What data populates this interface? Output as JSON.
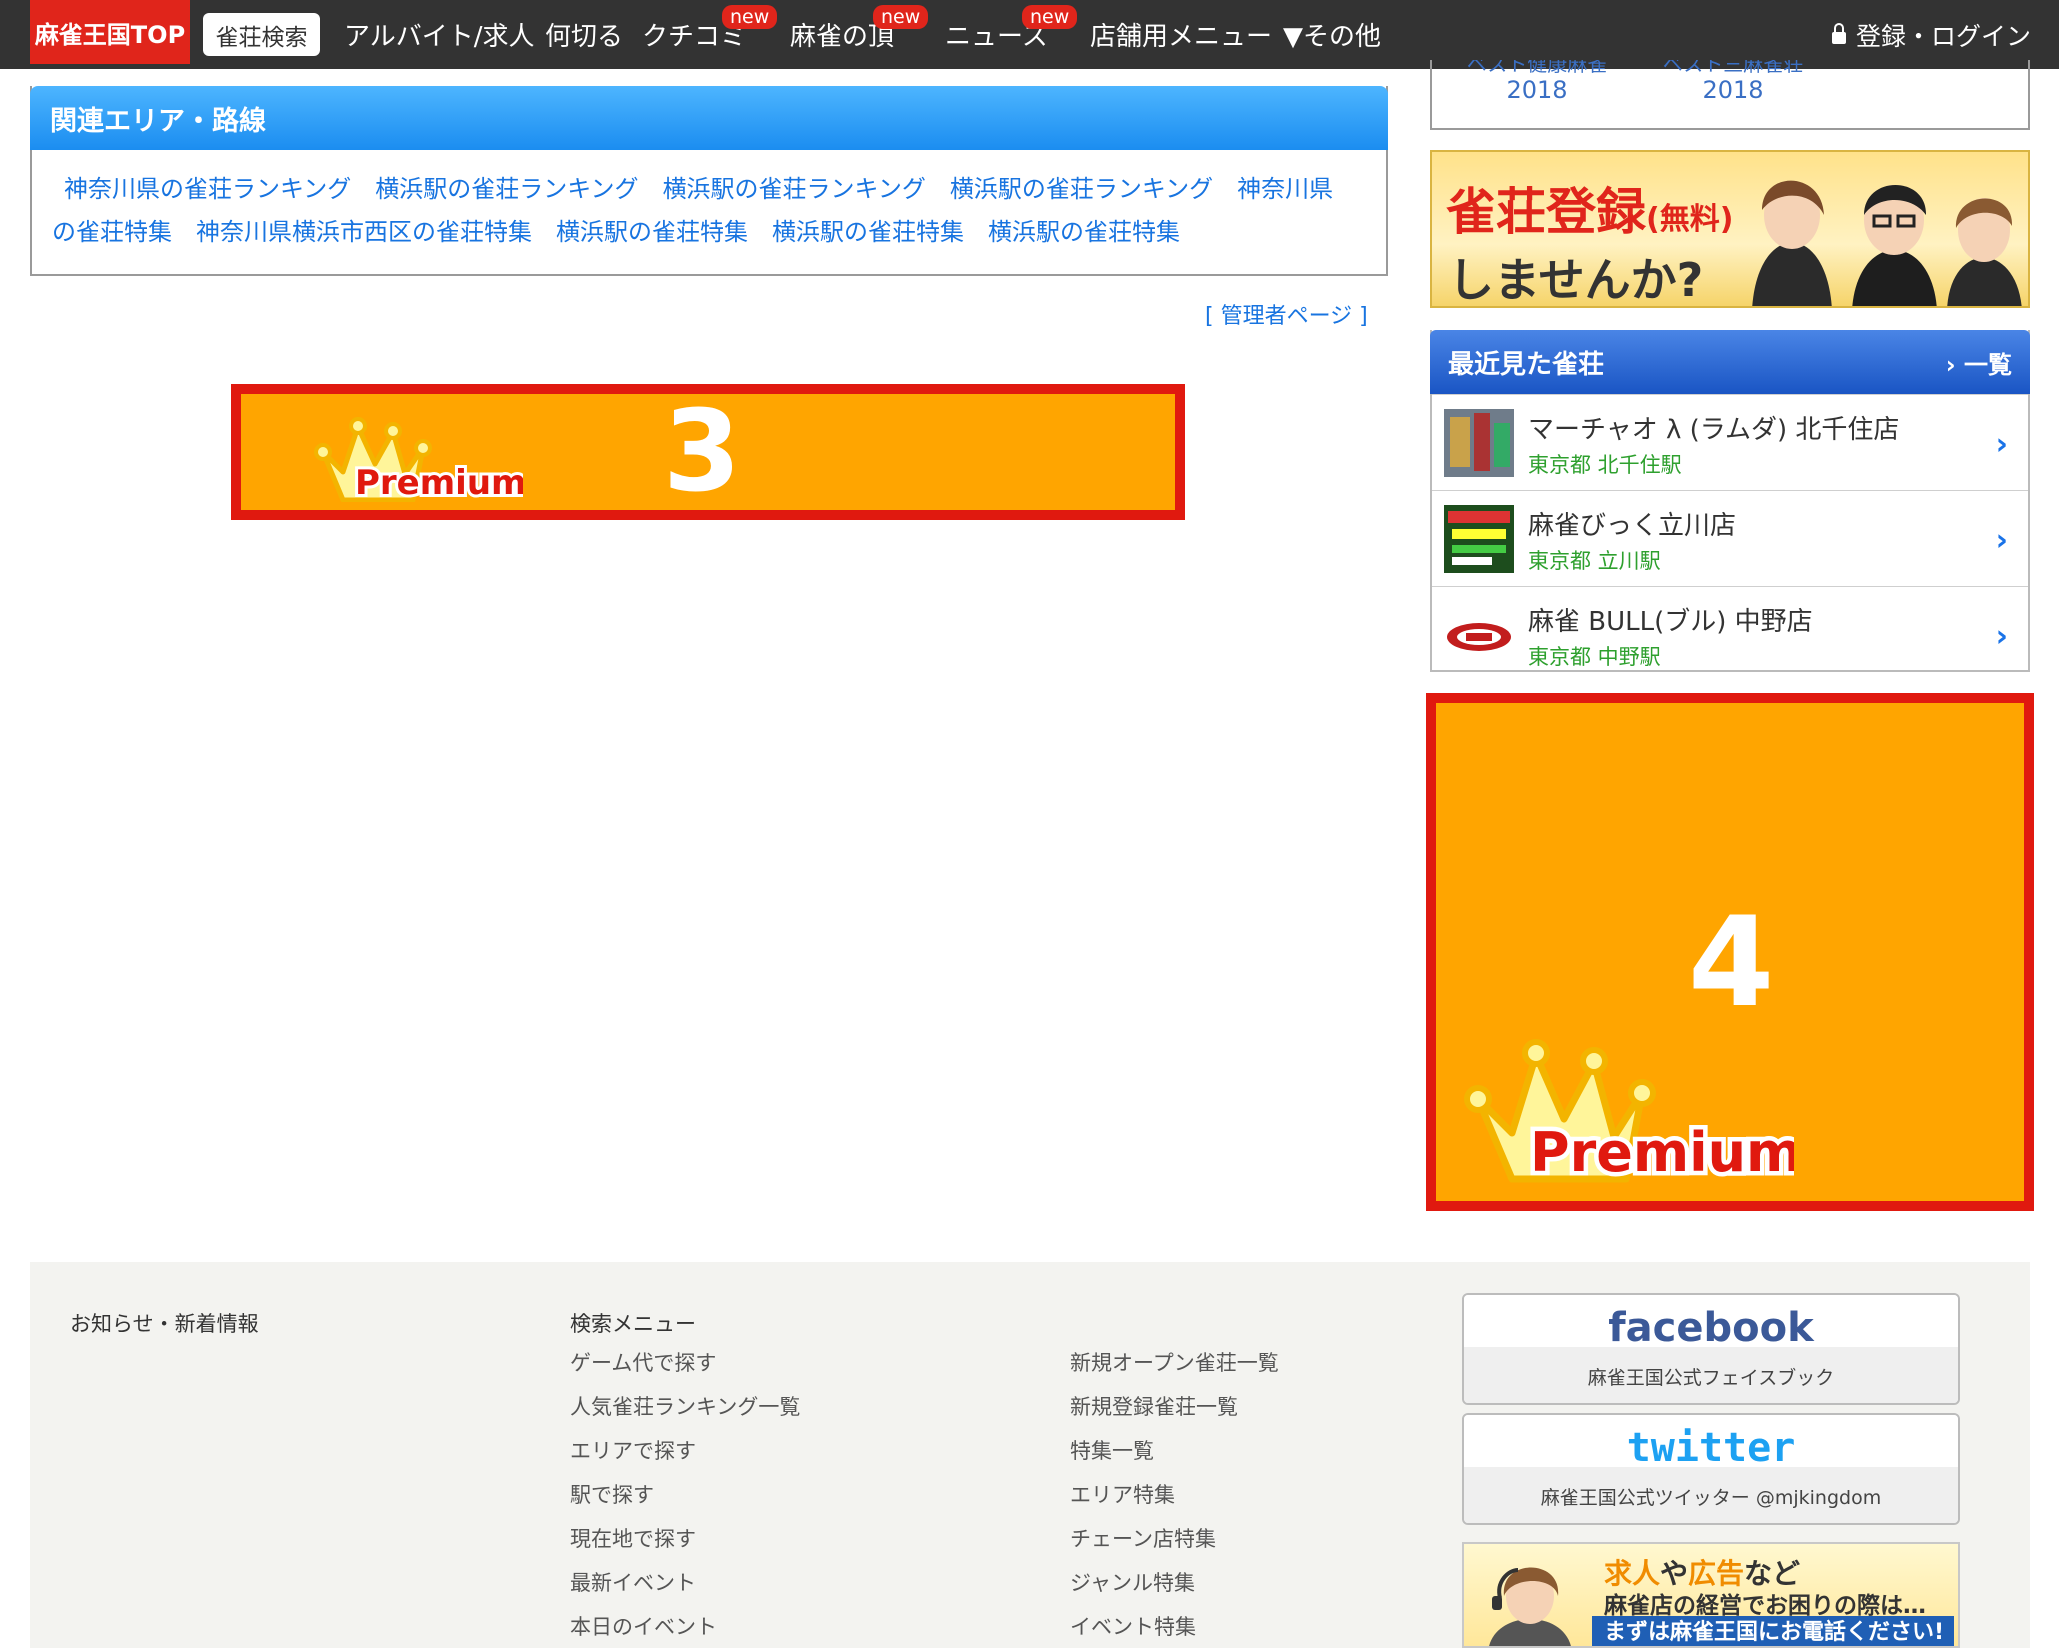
{
  "nav": {
    "top": "麻雀王国TOP",
    "search": "雀荘検索",
    "job": "アルバイト/求人",
    "nanikiru": "何切る",
    "kuchikomi": "クチコミ",
    "itadaki": "麻雀の頂",
    "news": "ニュース",
    "shop_menu": "店舗用メニュー",
    "other": "▼その他",
    "login": "登録・ログイン",
    "new_badge": "new"
  },
  "related": {
    "title": "関連エリア・路線",
    "links": [
      "神奈川県の雀荘ランキング",
      "横浜駅の雀荘ランキング",
      "横浜駅の雀荘ランキング",
      "横浜駅の雀荘ランキング",
      "神奈川県",
      "の雀荘特集",
      "神奈川県横浜市西区の雀荘特集",
      "横浜駅の雀荘特集",
      "横浜駅の雀荘特集",
      "横浜駅の雀荘特集"
    ]
  },
  "admin_link": "[ 管理者ページ ]",
  "premium": {
    "banner3_number": "3",
    "banner4_number": "4",
    "logo_text": "Premium"
  },
  "sidebar": {
    "awards": [
      {
        "label": "ベスト健康麻雀",
        "year": "2018"
      },
      {
        "label": "ベスト三麻雀荘",
        "year": "2018"
      }
    ],
    "signup": {
      "line1_main": "雀荘登録",
      "line1_small": "(無料)",
      "line2": "しませんか?"
    },
    "recent": {
      "title": "最近見た雀荘",
      "more": "一覧",
      "items": [
        {
          "name": "マーチャオ λ (ラムダ) 北千住店",
          "area": "東京都 北千住駅"
        },
        {
          "name": "麻雀びっく立川店",
          "area": "東京都 立川駅"
        },
        {
          "name": "麻雀 BULL(ブル) 中野店",
          "area": "東京都 中野駅"
        }
      ]
    }
  },
  "footer": {
    "news_title": "お知らせ・新着情報",
    "search_title": "検索メニュー",
    "col1": [
      "ゲーム代で探す",
      "人気雀荘ランキング一覧",
      "エリアで探す",
      "駅で探す",
      "現在地で探す",
      "最新イベント",
      "本日のイベント"
    ],
    "col2": [
      "新規オープン雀荘一覧",
      "新規登録雀荘一覧",
      "特集一覧",
      "エリア特集",
      "チェーン店特集",
      "ジャンル特集",
      "イベント特集"
    ],
    "facebook": {
      "logo": "facebook",
      "caption": "麻雀王国公式フェイスブック"
    },
    "twitter": {
      "logo": "twitter",
      "caption": "麻雀王国公式ツイッター @mjkingdom"
    },
    "contact": {
      "l1_hl1": "求人",
      "l1_mid": "や",
      "l1_hl2": "広告",
      "l1_end": "など",
      "l2": "麻雀店の経営でお困りの際は…",
      "l3": "まずは麻雀王国にお電話ください!"
    }
  },
  "colors": {
    "brand_red": "#e0251b",
    "premium_orange": "#ffa500",
    "link_blue": "#1874e0",
    "area_green": "#2ea02e"
  }
}
